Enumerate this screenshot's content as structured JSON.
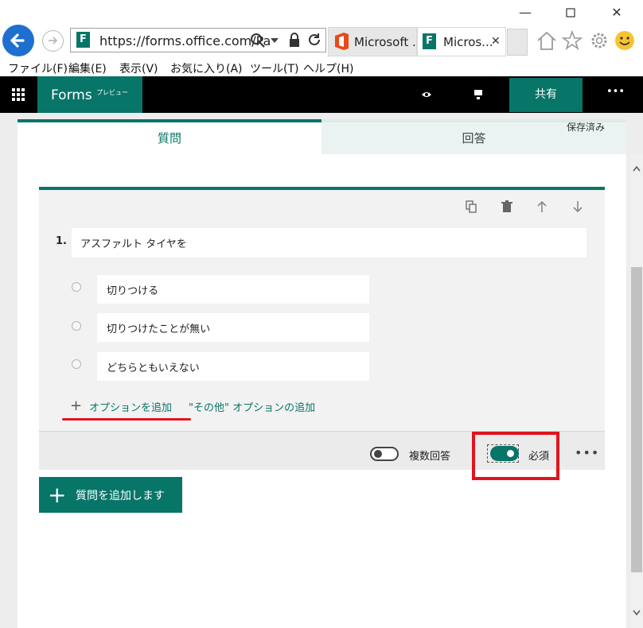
{
  "browser": {
    "url": "https://forms.office.com/Pa",
    "tabs": [
      {
        "label": "Microsoft ..."
      },
      {
        "label": "Micros..."
      }
    ],
    "menu": [
      "ファイル(F)",
      "編集(E)",
      "表示(V)",
      "お気に入り(A)",
      "ツール(T)",
      "ヘルプ(H)"
    ]
  },
  "header": {
    "app_name": "Forms",
    "badge": "プレビュー",
    "share_label": "共有",
    "more_label": "•••"
  },
  "tabs": {
    "questions": "質問",
    "responses": "回答",
    "saved_status": "保存済み"
  },
  "question": {
    "number": "1.",
    "text": "アスファルト タイヤを",
    "options": [
      "切りつける",
      "切りつけたことが無い",
      "どちらともいえない"
    ],
    "add_option": "オプションを追加",
    "add_other": "\"その他\" オプションの追加",
    "multi_answer_label": "複数回答",
    "multi_answer_on": false,
    "required_label": "必須",
    "required_on": true,
    "more_label": "•••"
  },
  "add_question_label": "質問を追加します",
  "colors": {
    "accent": "#077568",
    "highlight": "#e0141e",
    "browser_blue": "#1e6fd0"
  }
}
